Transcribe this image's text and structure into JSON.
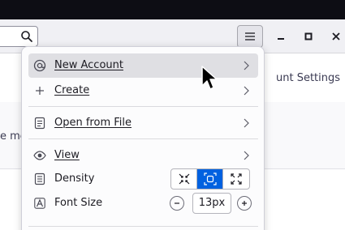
{
  "toolbar": {
    "search_icon": "search-icon",
    "hamburger_icon": "hamburger-icon"
  },
  "background": {
    "account_settings_fragment": "unt Settings",
    "left_fragment": "e me"
  },
  "menu": {
    "items": [
      {
        "label": "New Account",
        "icon": "at-sign-icon",
        "has_submenu": true
      },
      {
        "label": "Create",
        "icon": "plus-icon",
        "has_submenu": true
      },
      {
        "label": "Open from File",
        "icon": "file-icon",
        "has_submenu": true
      },
      {
        "label": "View",
        "icon": "eye-icon",
        "has_submenu": true
      },
      {
        "label": "Density",
        "icon": "density-icon"
      },
      {
        "label": "Font Size",
        "icon": "font-size-icon"
      }
    ],
    "density_options": [
      "compact",
      "normal",
      "relaxed"
    ],
    "density_selected": "normal",
    "font_size_value": "13px"
  },
  "colors": {
    "accent": "#0061e0",
    "hover": "#dfdfe3",
    "titlebar": "#0d0d14"
  }
}
